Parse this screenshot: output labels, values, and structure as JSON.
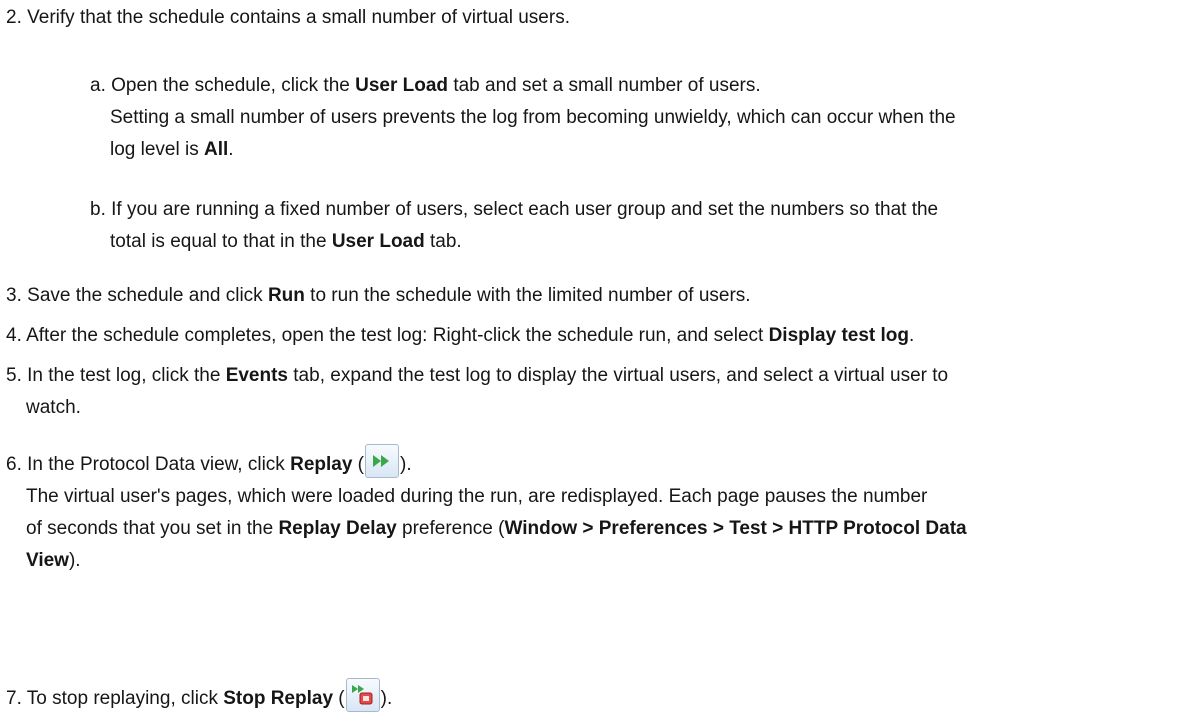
{
  "steps": {
    "s2": {
      "num": "2.",
      "text": "Verify that the schedule contains a small number of virtual users."
    },
    "s2a": {
      "num": "a.",
      "t1": "Open the schedule, click the ",
      "b1": "User Load",
      "t2": " tab and set a small number of users.",
      "note1": "Setting a small number of users prevents the log from becoming unwieldy, which can occur when the",
      "note2a": "log level is ",
      "note2b": "All",
      "note2c": "."
    },
    "s2b": {
      "num": "b.",
      "t1": "If you are running a fixed number of users, select each user group and set the numbers so that the",
      "t2": "total is equal to that in the ",
      "b1": "User Load",
      "t3": " tab."
    },
    "s3": {
      "num": "3.",
      "t1": "Save the schedule and click ",
      "b1": "Run",
      "t2": " to run the schedule with the limited number of users."
    },
    "s4": {
      "num": "4.",
      "t1": "After the schedule completes, open the test log: Right-click the schedule run, and select ",
      "b1": "Display test log",
      "t2": "."
    },
    "s5": {
      "num": "5.",
      "t1": "In the test log, click the ",
      "b1": "Events",
      "t2": " tab, expand the test log to display the virtual users, and select a virtual user to",
      "t3": "watch."
    },
    "s6": {
      "num": "6.",
      "t1": "In the Protocol Data view, click ",
      "b1": "Replay",
      "t2": " (",
      "t3": ").",
      "icon": "replay-icon",
      "p1": "The virtual user's pages, which were loaded during the run, are redisplayed. Each page pauses the number",
      "p2a": "of seconds that you set in the ",
      "p2b": "Replay Delay",
      "p2c": " preference (",
      "p2d": "Window > Preferences > Test > HTTP Protocol Data",
      "p3a": "View",
      "p3b": ")."
    },
    "s7": {
      "num": "7.",
      "t1": "To stop replaying, click ",
      "b1": "Stop Replay",
      "t2": " (",
      "t3": ").",
      "icon": "stop-replay-icon"
    }
  }
}
